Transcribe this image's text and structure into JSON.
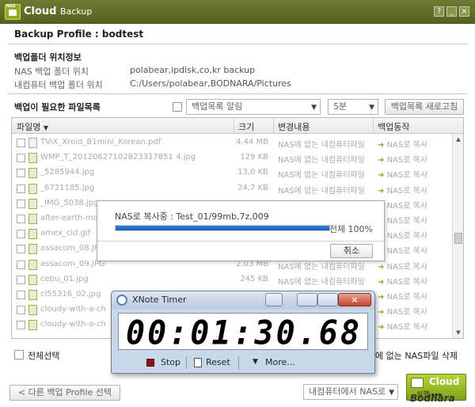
{
  "window": {
    "logo_text": "NAS",
    "title_bold": "Cloud",
    "title_light": "Backup"
  },
  "profile": {
    "title": "Backup Profile : bodtest"
  },
  "folder_info": {
    "section_title": "백업폴더 위치정보",
    "nas_label": "NAS 백업 폴더 위치",
    "nas_value": "polabear,ipdisk,co,kr backup",
    "pc_label": "내컴퓨터 백업 폴더 위치",
    "pc_value": "C:/Users/polabear,BODNARA/Pictures"
  },
  "file_list": {
    "section_title": "백업이 필요한 파일목록",
    "alert_select": "백업목록 알림",
    "interval_select": "5분",
    "refresh_button": "백업목록 새로고침",
    "columns": [
      "파일명",
      "크기",
      "변경내용",
      "백업동작"
    ],
    "rows": [
      {
        "name": "TViX_Xroid_B1mini_Korean.pdf",
        "size": "4,44 MB",
        "status": "NAS에 없는 내컴퓨터파일",
        "action": "NAS로 복사",
        "type": "doc"
      },
      {
        "name": "WMP_T_20120627102823317851 4.jpg",
        "size": "129 KB",
        "status": "NAS에 없는 내컴퓨터파일",
        "action": "NAS로 복사",
        "type": "img"
      },
      {
        "name": "_5285944.jpg",
        "size": "13,0 KB",
        "status": "NAS에 없는 내컴퓨터파일",
        "action": "NAS로 복사",
        "type": "img"
      },
      {
        "name": "_6721185.jpg",
        "size": "24,7 KB",
        "status": "NAS에 없는 내컴퓨터파일",
        "action": "NAS로 복사",
        "type": "img"
      },
      {
        "name": "_IMG_5038.jpg",
        "size": "",
        "status": "",
        "action": "NAS로 복사",
        "type": "img"
      },
      {
        "name": "after-earth-mo",
        "size": "",
        "status": "",
        "action": "NAS로 복사",
        "type": "img"
      },
      {
        "name": "amex_cid.gif",
        "size": "",
        "status": "",
        "action": "NAS로 복사",
        "type": "img"
      },
      {
        "name": "assacom_08.JP",
        "size": "",
        "status": "",
        "action": "NAS로 복사",
        "type": "img"
      },
      {
        "name": "assacom_09.JPG",
        "size": "2,03 MB",
        "status": "NAS에 없는 내컴퓨터파일",
        "action": "NAS로 복사",
        "type": "img"
      },
      {
        "name": "cebu_01.jpg",
        "size": "245 KB",
        "status": "NAS에 없는 내컴퓨터파일",
        "action": "NAS로 복사",
        "type": "img"
      },
      {
        "name": "cl55316_02.jpg",
        "size": "",
        "status": "",
        "action": "NAS로 복사",
        "type": "img"
      },
      {
        "name": "cloudy-with-a-ch",
        "size": "",
        "status": "",
        "action": "NAS로 복사",
        "type": "img"
      },
      {
        "name": "cloudy-with-a-ch",
        "size": "",
        "status": "",
        "action": "NAS로 복사",
        "type": "img"
      }
    ]
  },
  "progress_dialog": {
    "label": "NAS로 복사중 : Test_01/99mb,7z,009",
    "progress": 1.0,
    "total_label": "전체 100%",
    "cancel_button": "취소"
  },
  "timer": {
    "title": "XNote Timer",
    "display": "00:01:30.68",
    "stop_label": "Stop",
    "reset_label": "Reset",
    "more_label": "More..."
  },
  "footer": {
    "select_all": "전체선택",
    "delete_hint": "에 없는 NAS파일 삭제",
    "back_button": "< 다른 백업 Profile 선택",
    "direction_select": "내컴퓨터에서 NAS로",
    "cloud_button_big": "Cloud",
    "cloud_button_small": "실행 ▸▸▸",
    "watermark": "Bodnara"
  }
}
